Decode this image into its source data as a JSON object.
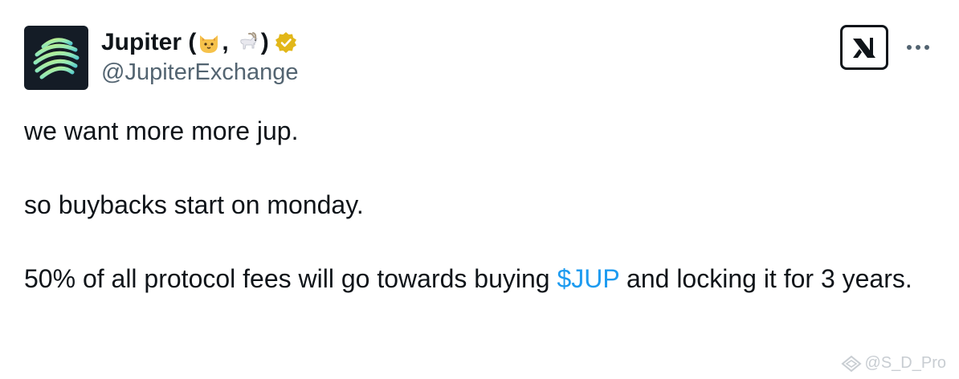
{
  "author": {
    "name_prefix": "Jupiter (",
    "name_separator": ",",
    "name_suffix": ")",
    "name_emojis": [
      "cat-face-emoji",
      "goat-emoji"
    ],
    "verified_badge": "gold-verified-badge",
    "handle": "@JupiterExchange",
    "avatar_icon": "jupiter-logo",
    "avatar_background": "#141c26"
  },
  "actions": {
    "grok_icon": "grok-icon",
    "more_icon": "more-horizontal-icon"
  },
  "tweet": {
    "line1": "we want more more jup.",
    "line2": "so buybacks start on monday.",
    "line3_before": "50% of all protocol fees will go towards buying ",
    "cashtag": "$JUP",
    "line3_after": " and locking it for 3 years."
  },
  "watermark": {
    "text": "@S_D_Pro"
  },
  "colors": {
    "text": "#0f1419",
    "secondary": "#536471",
    "link": "#1d9bf0",
    "verified": "#e2b719"
  }
}
